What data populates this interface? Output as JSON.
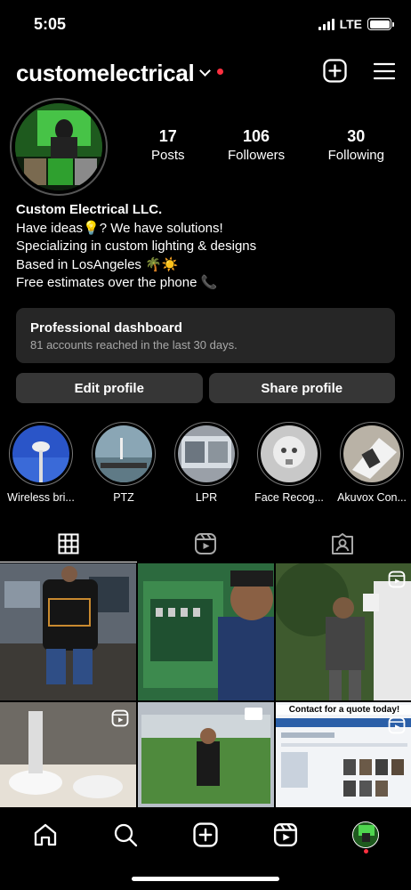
{
  "status": {
    "time": "5:05",
    "network": "LTE"
  },
  "header": {
    "username": "customelectrical"
  },
  "stats": [
    {
      "num": "17",
      "label": "Posts"
    },
    {
      "num": "106",
      "label": "Followers"
    },
    {
      "num": "30",
      "label": "Following"
    }
  ],
  "bio": {
    "name": "Custom Electrical LLC.",
    "lines": [
      "Have ideas💡? We have solutions!",
      "Specializing in custom lighting & designs",
      "Based in LosAngeles 🌴☀️",
      "Free estimates over the phone 📞"
    ]
  },
  "dashboard": {
    "title": "Professional dashboard",
    "subtitle": "81 accounts reached in the last 30 days."
  },
  "buttons": {
    "edit": "Edit profile",
    "share": "Share profile"
  },
  "highlights": [
    {
      "label": "Wireless bri..."
    },
    {
      "label": "PTZ"
    },
    {
      "label": "LPR"
    },
    {
      "label": "Face Recog..."
    },
    {
      "label": "Akuvox Con..."
    }
  ],
  "grid": {
    "quote_text": "Contact for a quote today!"
  },
  "colors": {
    "background": "#000000",
    "notification": "#ff3040",
    "card": "#262626",
    "button": "#363636"
  }
}
